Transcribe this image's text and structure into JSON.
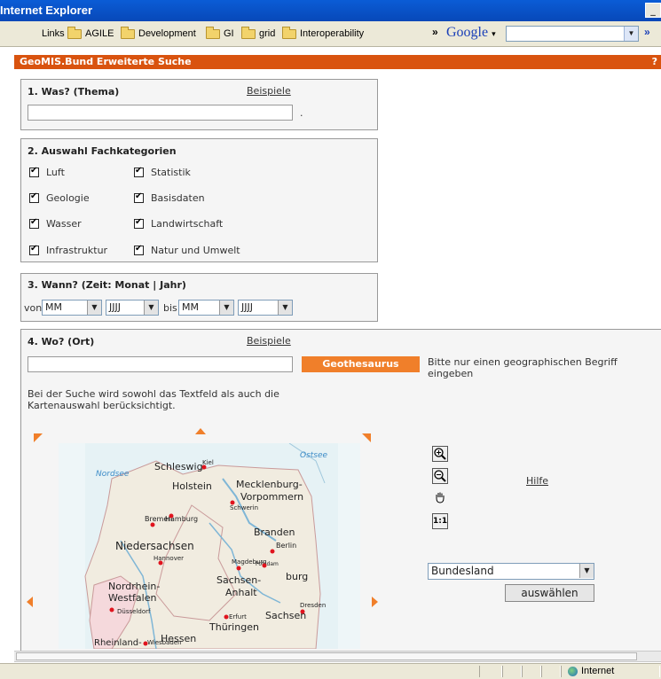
{
  "window": {
    "title": "Internet Explorer",
    "sys_button": "_"
  },
  "links_bar": {
    "label": "Links",
    "items": [
      "AGILE",
      "Development",
      "GI",
      "grid",
      "Interoperability"
    ],
    "chevron": "»",
    "google_label": "Google",
    "google_dropdown": "▾",
    "more": "»"
  },
  "header": {
    "title": "GeoMIS.Bund Erweiterte Suche",
    "help": "?"
  },
  "section1": {
    "title": "1. Was? (Thema)",
    "examples_link": "Beispiele",
    "input_value": "",
    "dot": "."
  },
  "section2": {
    "title": "2. Auswahl Fachkategorien",
    "left": [
      "Luft",
      "Geologie",
      "Wasser",
      "Infrastruktur"
    ],
    "right": [
      "Statistik",
      "Basisdaten",
      "Landwirtschaft",
      "Natur und Umwelt"
    ]
  },
  "section3": {
    "title": "3. Wann? (Zeit: Monat | Jahr)",
    "von": "von",
    "bis": "bis",
    "month_placeholder": "MM",
    "year_placeholder": "JJJJ"
  },
  "section4": {
    "title": "4. Wo? (Ort)",
    "examples_link": "Beispiele",
    "input_value": "",
    "geothesaurus_button": "Geothesaurus",
    "hint": "Bitte nur einen geographischen Begriff eingeben",
    "note": "Bei der Suche wird sowohl das Textfeld als auch die Kartenauswahl berücksichtigt.",
    "help_link": "Hilfe",
    "zoom_11": "1:1",
    "region_select": "Bundesland",
    "select_button": "auswählen"
  },
  "map": {
    "labels": [
      "Ostsee",
      "Nordsee",
      "Schleswig-",
      "Kiel",
      "Holstein",
      "Mecklenburg-",
      "Vorpommern",
      "Schwerin",
      "Bremen",
      "Hamburg",
      "Branden",
      "Berlin",
      "Niedersachsen",
      "Hannover",
      "Magdeburg",
      "Potsdam",
      "burg",
      "Sachsen-",
      "Anhalt",
      "Nordrhein-",
      "Westfalen",
      "Düsseldorf",
      "Dresden",
      "Sachsen",
      "Erfurt",
      "Thüringen",
      "Hessen",
      "Rheinland-",
      "Wiesbaden"
    ]
  },
  "status": {
    "zone": "Internet"
  }
}
